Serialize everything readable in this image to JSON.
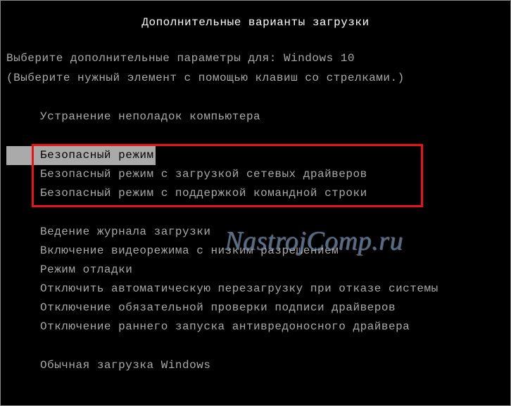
{
  "title": "Дополнительные варианты загрузки",
  "instruction": {
    "prefix": "Выберите дополнительные параметры для: ",
    "os": "Windows 10"
  },
  "hint": "(Выберите нужный элемент с помощью клавиш со стрелками.)",
  "menu": {
    "repair": "Устранение неполадок компьютера",
    "safe_mode": "Безопасный режим",
    "safe_mode_net": "Безопасный режим с загрузкой сетевых драйверов",
    "safe_mode_cmd": "Безопасный режим с поддержкой командной строки",
    "boot_log": "Ведение журнала загрузки",
    "low_res": "Включение видеорежима с низким разрешением",
    "debug": "Режим отладки",
    "no_auto_restart": "Отключить автоматическую перезагрузку при отказе системы",
    "disable_sig": "Отключение обязательной проверки подписи драйверов",
    "disable_elam": "Отключение раннего запуска антивредоносного драйвера",
    "normal": "Обычная загрузка Windows"
  },
  "watermark": "NastrojComp.ru",
  "highlight_color": "#e11"
}
